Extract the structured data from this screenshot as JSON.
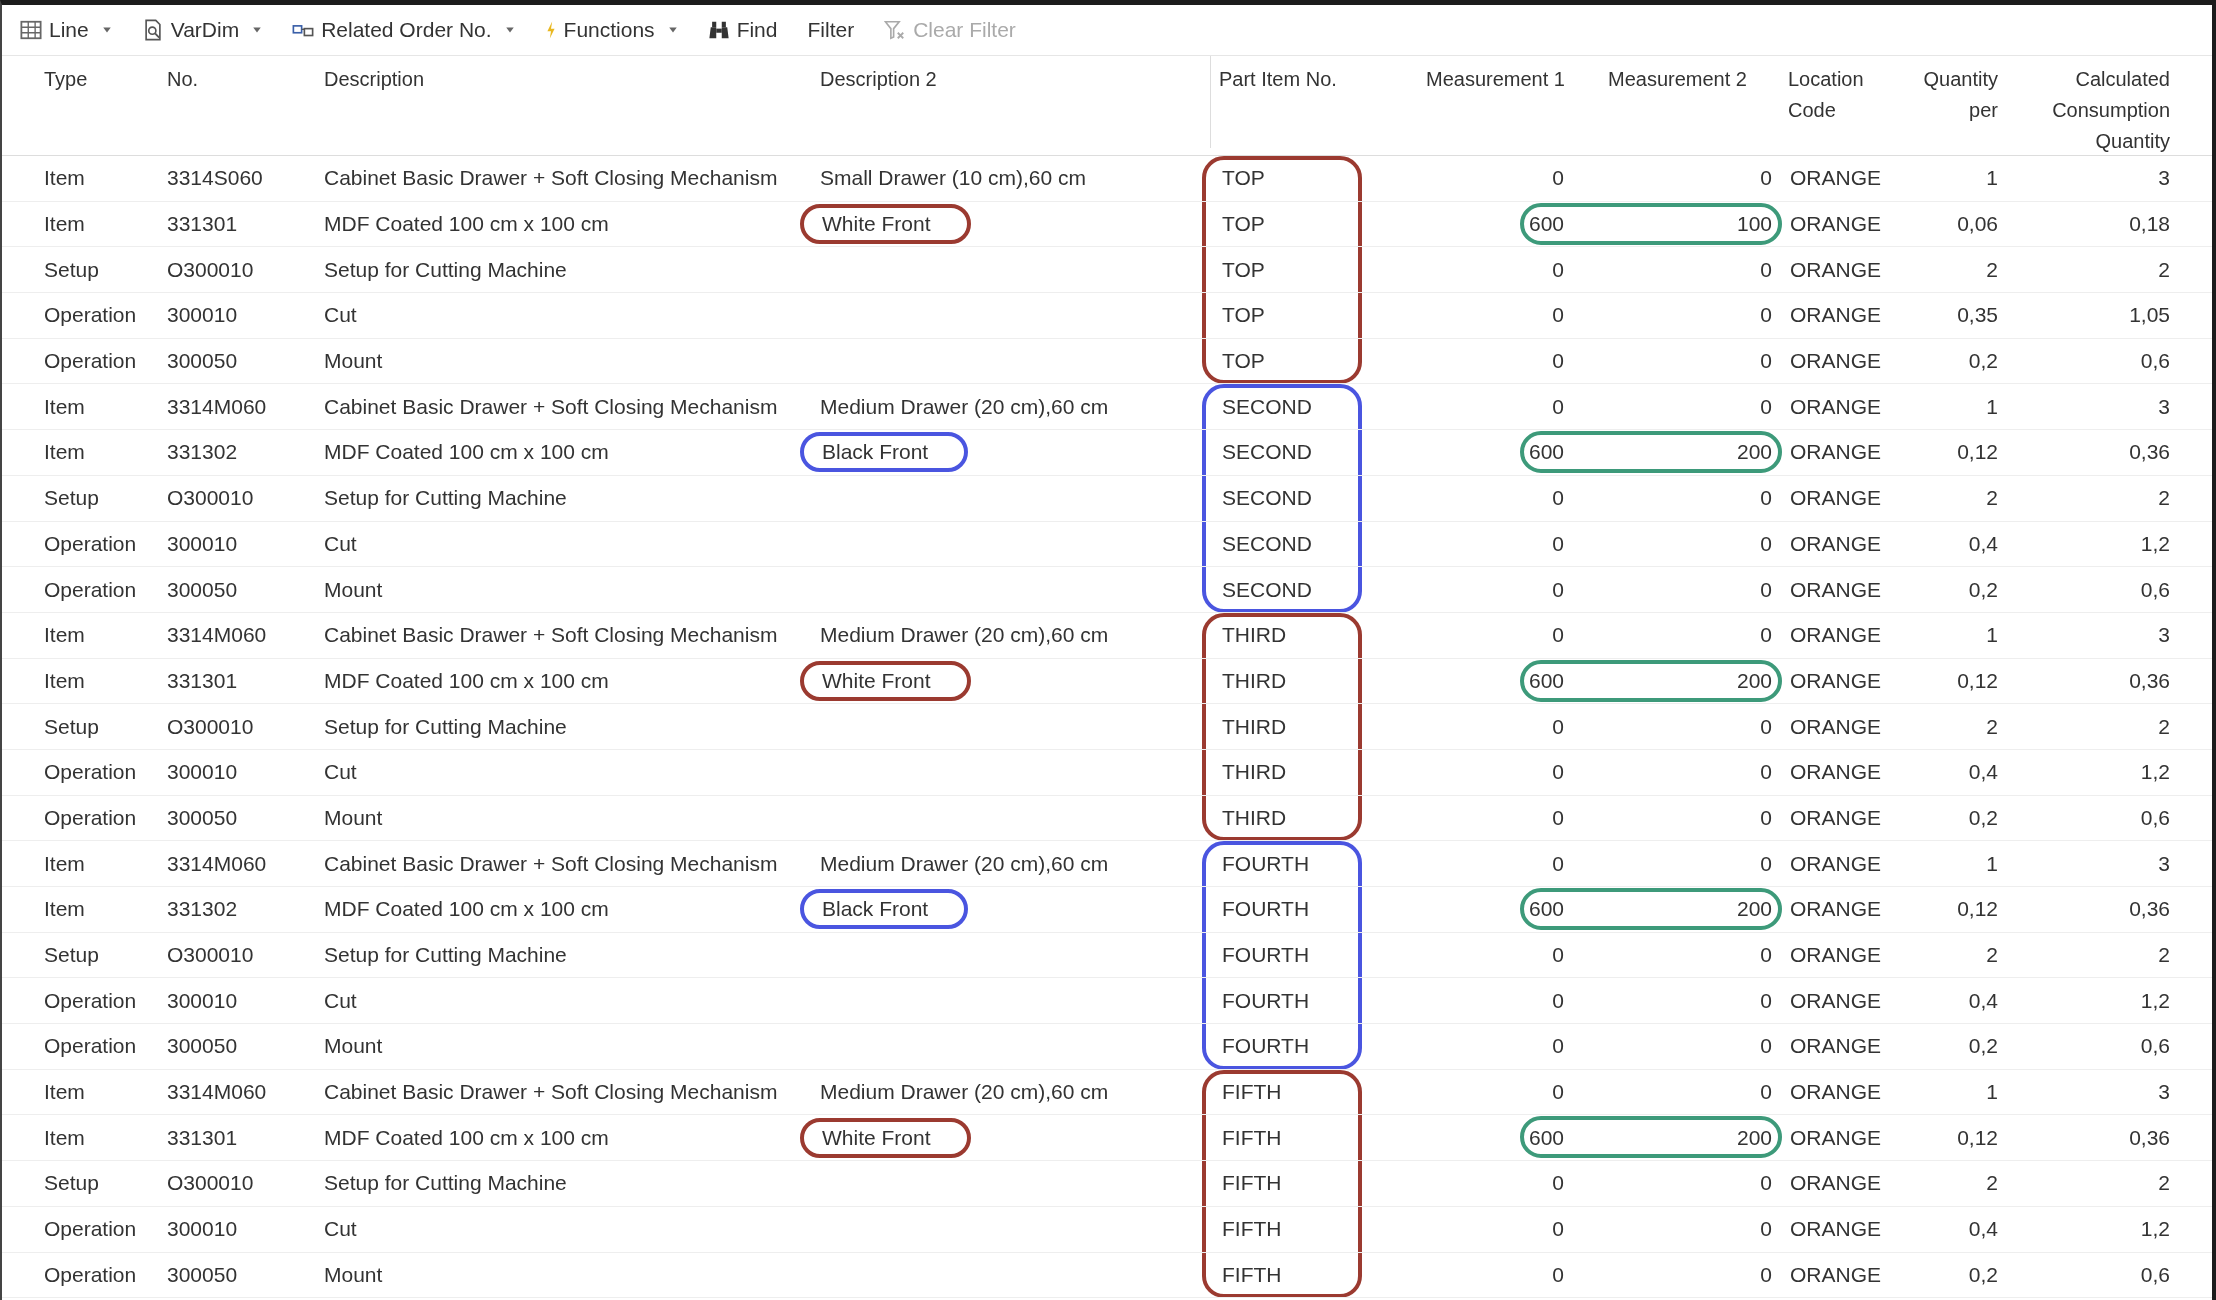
{
  "toolbar": {
    "items": [
      {
        "label": "Line",
        "kind": "dropdown",
        "disabled": false
      },
      {
        "label": "VarDim",
        "kind": "dropdown",
        "disabled": false
      },
      {
        "label": "Related Order No.",
        "kind": "dropdown",
        "disabled": false
      },
      {
        "label": "Functions",
        "kind": "dropdown",
        "disabled": false
      },
      {
        "label": "Find",
        "kind": "button",
        "disabled": false
      },
      {
        "label": "Filter",
        "kind": "button",
        "disabled": false
      },
      {
        "label": "Clear Filter",
        "kind": "button",
        "disabled": true
      }
    ]
  },
  "table": {
    "columns": [
      {
        "label": "Type"
      },
      {
        "label": "No."
      },
      {
        "label": "Description"
      },
      {
        "label": "Description 2"
      },
      {
        "label": "Part Item No."
      },
      {
        "label": "Measurement 1"
      },
      {
        "label": "Measurement 2"
      },
      {
        "label": "Location Code"
      },
      {
        "label": "Quantity per"
      },
      {
        "label": "Calculated Consumption Quantity"
      }
    ],
    "groups": [
      {
        "color": "#9b3a30",
        "rows": [
          {
            "type": "Item",
            "no": "3314S060",
            "description": "Cabinet Basic Drawer + Soft Closing Mechanism",
            "description_2": "Small Drawer (10 cm),60 cm",
            "description_2_circled": false,
            "part_item_no": "TOP",
            "measurement_1": "0",
            "measurement_2": "0",
            "measurements_circled": false,
            "location_code": "ORANGE",
            "quantity_per": "1",
            "consumption": "3"
          },
          {
            "type": "Item",
            "no": "331301",
            "description": "MDF Coated 100 cm x 100 cm",
            "description_2": "White Front",
            "description_2_circled": true,
            "part_item_no": "TOP",
            "measurement_1": "600",
            "measurement_2": "100",
            "measurements_circled": true,
            "location_code": "ORANGE",
            "quantity_per": "0,06",
            "consumption": "0,18"
          },
          {
            "type": "Setup",
            "no": "O300010",
            "description": "Setup for Cutting Machine",
            "part_item_no": "TOP",
            "measurement_1": "0",
            "measurement_2": "0",
            "measurements_circled": false,
            "location_code": "ORANGE",
            "quantity_per": "2",
            "consumption": "2"
          },
          {
            "type": "Operation",
            "no": "300010",
            "description": "Cut",
            "part_item_no": "TOP",
            "measurement_1": "0",
            "measurement_2": "0",
            "measurements_circled": false,
            "location_code": "ORANGE",
            "quantity_per": "0,35",
            "consumption": "1,05"
          },
          {
            "type": "Operation",
            "no": "300050",
            "description": "Mount",
            "part_item_no": "TOP",
            "measurement_1": "0",
            "measurement_2": "0",
            "measurements_circled": false,
            "location_code": "ORANGE",
            "quantity_per": "0,2",
            "consumption": "0,6"
          }
        ]
      },
      {
        "color": "#4a55e0",
        "rows": [
          {
            "type": "Item",
            "no": "3314M060",
            "description": "Cabinet Basic Drawer + Soft Closing Mechanism",
            "description_2": "Medium Drawer (20 cm),60 cm",
            "description_2_circled": false,
            "part_item_no": "SECOND",
            "measurement_1": "0",
            "measurement_2": "0",
            "measurements_circled": false,
            "location_code": "ORANGE",
            "quantity_per": "1",
            "consumption": "3"
          },
          {
            "type": "Item",
            "no": "331302",
            "description": "MDF Coated 100 cm x 100 cm",
            "description_2": "Black Front",
            "description_2_circled": true,
            "part_item_no": "SECOND",
            "measurement_1": "600",
            "measurement_2": "200",
            "measurements_circled": true,
            "location_code": "ORANGE",
            "quantity_per": "0,12",
            "consumption": "0,36"
          },
          {
            "type": "Setup",
            "no": "O300010",
            "description": "Setup for Cutting Machine",
            "part_item_no": "SECOND",
            "measurement_1": "0",
            "measurement_2": "0",
            "measurements_circled": false,
            "location_code": "ORANGE",
            "quantity_per": "2",
            "consumption": "2"
          },
          {
            "type": "Operation",
            "no": "300010",
            "description": "Cut",
            "part_item_no": "SECOND",
            "measurement_1": "0",
            "measurement_2": "0",
            "measurements_circled": false,
            "location_code": "ORANGE",
            "quantity_per": "0,4",
            "consumption": "1,2"
          },
          {
            "type": "Operation",
            "no": "300050",
            "description": "Mount",
            "part_item_no": "SECOND",
            "measurement_1": "0",
            "measurement_2": "0",
            "measurements_circled": false,
            "location_code": "ORANGE",
            "quantity_per": "0,2",
            "consumption": "0,6"
          }
        ]
      },
      {
        "color": "#9b3a30",
        "rows": [
          {
            "type": "Item",
            "no": "3314M060",
            "description": "Cabinet Basic Drawer + Soft Closing Mechanism",
            "description_2": "Medium Drawer (20 cm),60 cm",
            "description_2_circled": false,
            "part_item_no": "THIRD",
            "measurement_1": "0",
            "measurement_2": "0",
            "measurements_circled": false,
            "location_code": "ORANGE",
            "quantity_per": "1",
            "consumption": "3"
          },
          {
            "type": "Item",
            "no": "331301",
            "description": "MDF Coated 100 cm x 100 cm",
            "description_2": "White Front",
            "description_2_circled": true,
            "part_item_no": "THIRD",
            "measurement_1": "600",
            "measurement_2": "200",
            "measurements_circled": true,
            "location_code": "ORANGE",
            "quantity_per": "0,12",
            "consumption": "0,36"
          },
          {
            "type": "Setup",
            "no": "O300010",
            "description": "Setup for Cutting Machine",
            "part_item_no": "THIRD",
            "measurement_1": "0",
            "measurement_2": "0",
            "measurements_circled": false,
            "location_code": "ORANGE",
            "quantity_per": "2",
            "consumption": "2"
          },
          {
            "type": "Operation",
            "no": "300010",
            "description": "Cut",
            "part_item_no": "THIRD",
            "measurement_1": "0",
            "measurement_2": "0",
            "measurements_circled": false,
            "location_code": "ORANGE",
            "quantity_per": "0,4",
            "consumption": "1,2"
          },
          {
            "type": "Operation",
            "no": "300050",
            "description": "Mount",
            "part_item_no": "THIRD",
            "measurement_1": "0",
            "measurement_2": "0",
            "measurements_circled": false,
            "location_code": "ORANGE",
            "quantity_per": "0,2",
            "consumption": "0,6"
          }
        ]
      },
      {
        "color": "#4a55e0",
        "rows": [
          {
            "type": "Item",
            "no": "3314M060",
            "description": "Cabinet Basic Drawer + Soft Closing Mechanism",
            "description_2": "Medium Drawer (20 cm),60 cm",
            "description_2_circled": false,
            "part_item_no": "FOURTH",
            "measurement_1": "0",
            "measurement_2": "0",
            "measurements_circled": false,
            "location_code": "ORANGE",
            "quantity_per": "1",
            "consumption": "3"
          },
          {
            "type": "Item",
            "no": "331302",
            "description": "MDF Coated 100 cm x 100 cm",
            "description_2": "Black Front",
            "description_2_circled": true,
            "part_item_no": "FOURTH",
            "measurement_1": "600",
            "measurement_2": "200",
            "measurements_circled": true,
            "location_code": "ORANGE",
            "quantity_per": "0,12",
            "consumption": "0,36"
          },
          {
            "type": "Setup",
            "no": "O300010",
            "description": "Setup for Cutting Machine",
            "part_item_no": "FOURTH",
            "measurement_1": "0",
            "measurement_2": "0",
            "measurements_circled": false,
            "location_code": "ORANGE",
            "quantity_per": "2",
            "consumption": "2"
          },
          {
            "type": "Operation",
            "no": "300010",
            "description": "Cut",
            "part_item_no": "FOURTH",
            "measurement_1": "0",
            "measurement_2": "0",
            "measurements_circled": false,
            "location_code": "ORANGE",
            "quantity_per": "0,4",
            "consumption": "1,2"
          },
          {
            "type": "Operation",
            "no": "300050",
            "description": "Mount",
            "part_item_no": "FOURTH",
            "measurement_1": "0",
            "measurement_2": "0",
            "measurements_circled": false,
            "location_code": "ORANGE",
            "quantity_per": "0,2",
            "consumption": "0,6"
          }
        ]
      },
      {
        "color": "#9b3a30",
        "rows": [
          {
            "type": "Item",
            "no": "3314M060",
            "description": "Cabinet Basic Drawer + Soft Closing Mechanism",
            "description_2": "Medium Drawer (20 cm),60 cm",
            "description_2_circled": false,
            "part_item_no": "FIFTH",
            "measurement_1": "0",
            "measurement_2": "0",
            "measurements_circled": false,
            "location_code": "ORANGE",
            "quantity_per": "1",
            "consumption": "3"
          },
          {
            "type": "Item",
            "no": "331301",
            "description": "MDF Coated 100 cm x 100 cm",
            "description_2": "White Front",
            "description_2_circled": true,
            "part_item_no": "FIFTH",
            "measurement_1": "600",
            "measurement_2": "200",
            "measurements_circled": true,
            "location_code": "ORANGE",
            "quantity_per": "0,12",
            "consumption": "0,36"
          },
          {
            "type": "Setup",
            "no": "O300010",
            "description": "Setup for Cutting Machine",
            "part_item_no": "FIFTH",
            "measurement_1": "0",
            "measurement_2": "0",
            "measurements_circled": false,
            "location_code": "ORANGE",
            "quantity_per": "2",
            "consumption": "2"
          },
          {
            "type": "Operation",
            "no": "300010",
            "description": "Cut",
            "part_item_no": "FIFTH",
            "measurement_1": "0",
            "measurement_2": "0",
            "measurements_circled": false,
            "location_code": "ORANGE",
            "quantity_per": "0,4",
            "consumption": "1,2"
          },
          {
            "type": "Operation",
            "no": "300050",
            "description": "Mount",
            "part_item_no": "FIFTH",
            "measurement_1": "0",
            "measurement_2": "0",
            "measurements_circled": false,
            "location_code": "ORANGE",
            "quantity_per": "0,2",
            "consumption": "0,6"
          }
        ]
      }
    ]
  }
}
